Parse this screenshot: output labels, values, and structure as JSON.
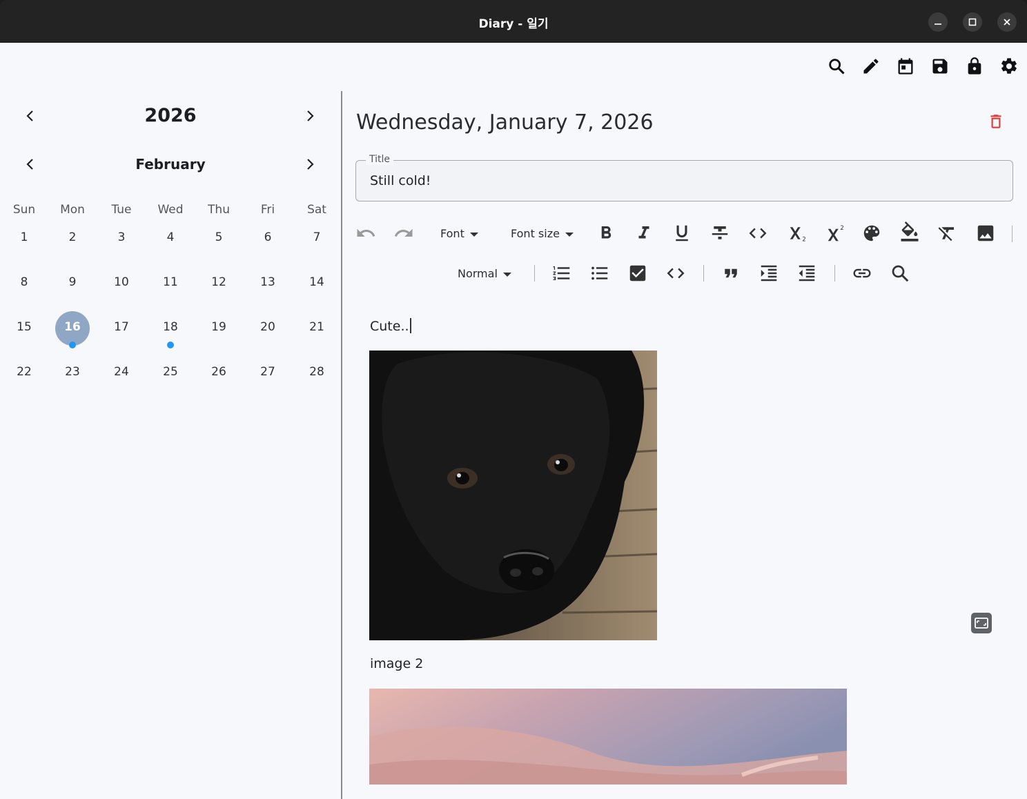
{
  "window": {
    "title": "Diary - 일기"
  },
  "toolbar_icons": [
    "search-icon",
    "edit-icon",
    "calendar-icon",
    "save-icon",
    "lock-icon",
    "settings-icon"
  ],
  "calendar": {
    "year": "2026",
    "month": "February",
    "weekdays": [
      "Sun",
      "Mon",
      "Tue",
      "Wed",
      "Thu",
      "Fri",
      "Sat"
    ],
    "weeks": [
      [
        "1",
        "2",
        "3",
        "4",
        "5",
        "6",
        "7"
      ],
      [
        "8",
        "9",
        "10",
        "11",
        "12",
        "13",
        "14"
      ],
      [
        "15",
        "16",
        "17",
        "18",
        "19",
        "20",
        "21"
      ],
      [
        "22",
        "23",
        "24",
        "25",
        "26",
        "27",
        "28"
      ]
    ],
    "selected_day": "16",
    "days_with_entries": [
      "16",
      "18"
    ],
    "selected_color": "#8fa7c5",
    "entry_dot_color": "#2196f3"
  },
  "entry": {
    "date_heading": "Wednesday, January 7, 2026",
    "title_label": "Title",
    "title_value": "Still cold!",
    "body_text_1": "Cute..",
    "image_caption_2": "image 2",
    "delete_color": "#e53935"
  },
  "editor_toolbar": {
    "font_label": "Font",
    "font_size_label": "Font size",
    "block_style_label": "Normal"
  }
}
